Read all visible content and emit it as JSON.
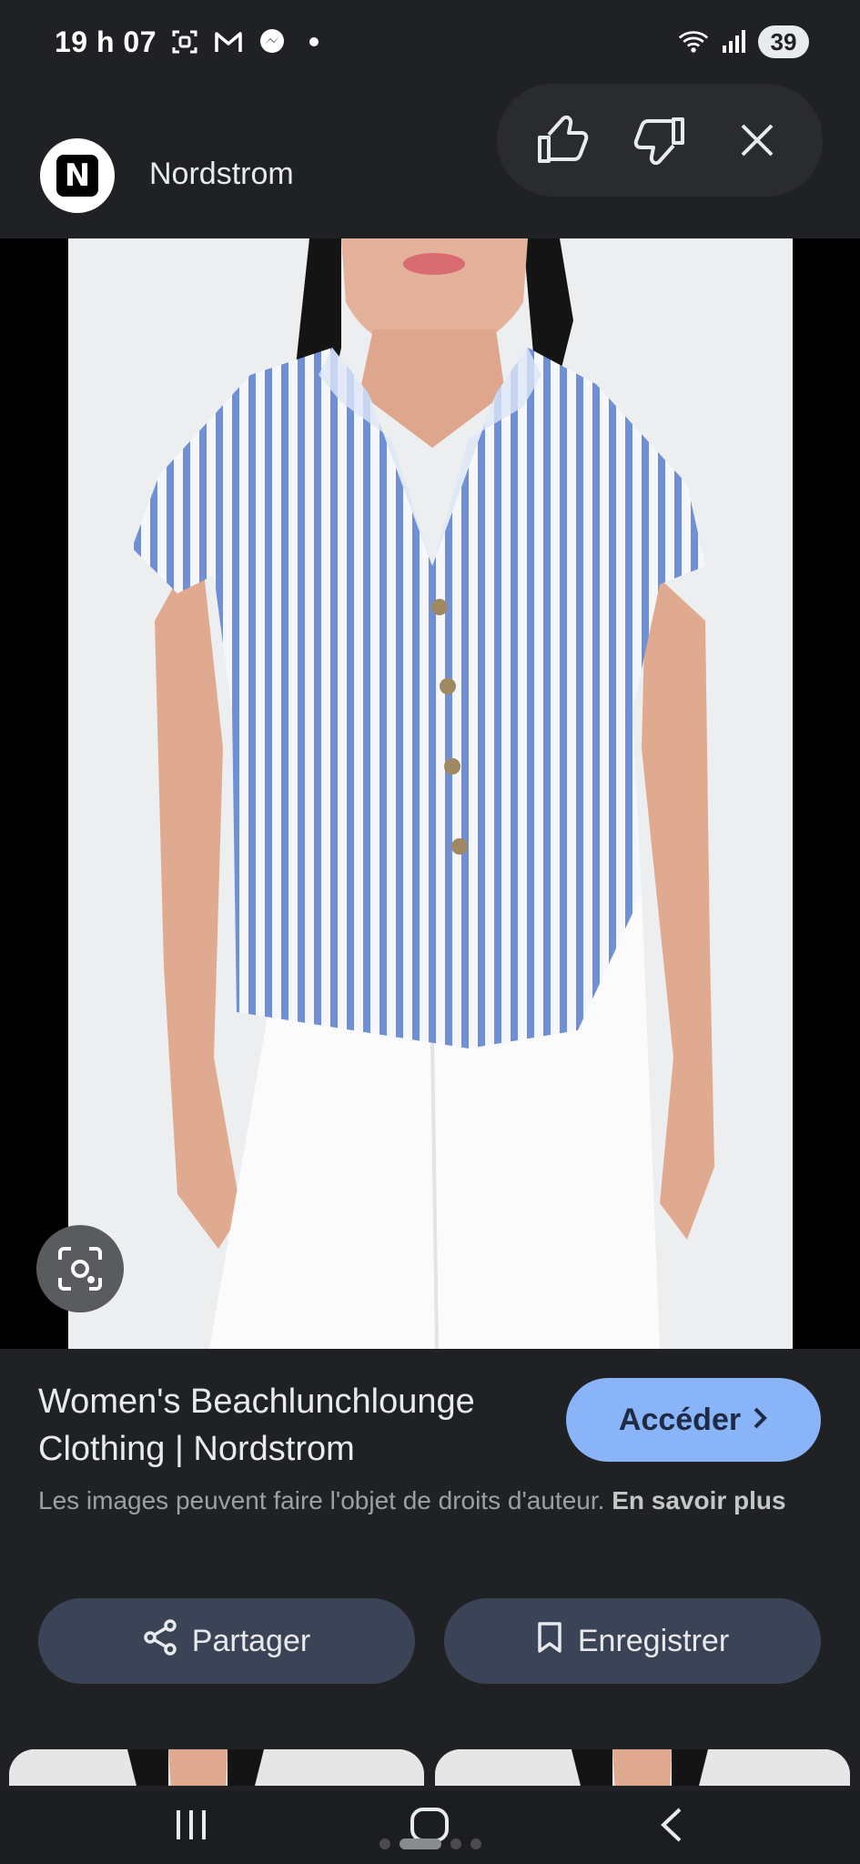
{
  "status_bar": {
    "time": "19 h 07",
    "battery": "39",
    "icons": [
      "screenshot-icon",
      "gmail-icon",
      "messenger-icon",
      "wifi-icon",
      "signal-icon"
    ]
  },
  "source": {
    "logo_letter": "N",
    "name": "Nordstrom"
  },
  "feedback": {
    "icons": [
      "thumbs-up-icon",
      "thumbs-down-icon",
      "close-icon"
    ]
  },
  "result": {
    "title": "Women's Beachlunchlounge Clothing | Nordstrom",
    "visit_label": "Accéder",
    "copyright_text": "Les images peuvent faire l'objet de droits d'auteur.",
    "learn_more": "En savoir plus",
    "share_label": "Partager",
    "save_label": "Enregistrer"
  },
  "colors": {
    "background": "#202124",
    "accent": "#8ab4f8",
    "action_button": "#3b4456"
  },
  "pager": {
    "count": 4,
    "active": 1
  }
}
